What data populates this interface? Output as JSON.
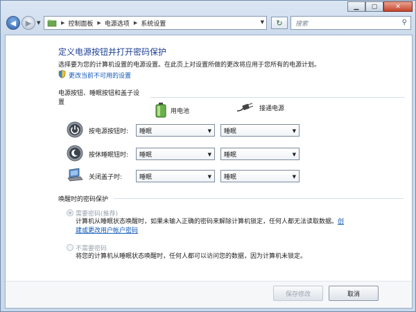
{
  "address": {
    "crumbs": [
      "控制面板",
      "电源选项",
      "系统设置"
    ]
  },
  "search": {
    "placeholder": "搜索"
  },
  "header": {
    "title": "定义电源按钮并打开密码保护",
    "description": "选择要为您的计算机设置的电源设置。在此页上对设置所做的更改将应用于您所有的电源计划。",
    "change_link": "更改当前不可用的设置"
  },
  "power_section": {
    "label": "电源按钮、睡眠按钮和盖子设置",
    "col_battery": "用电池",
    "col_plugged": "接通电源",
    "rows": [
      {
        "label": "按电源按钮时:",
        "battery": "睡眠",
        "plugged": "睡眠"
      },
      {
        "label": "按休睡眠钮时:",
        "battery": "睡眠",
        "plugged": "睡眠"
      },
      {
        "label": "关闭盖子时:",
        "battery": "睡眠",
        "plugged": "睡眠"
      }
    ]
  },
  "password_section": {
    "label": "唤醒时的密码保护",
    "option_require": {
      "label": "需要密码(推荐)",
      "desc_line1": "计算机从睡眠状态唤醒时，如果未输入正确的密码来解除计算机锁定，任何人都无法读取数据。",
      "link_part1": "创",
      "link_part2": "建或更改用户帐户密码"
    },
    "option_none": {
      "label": "不需要密码",
      "desc": "将您的计算机从睡眠状态唤醒时，任何人都可以访问您的数据，因为计算机未锁定。"
    }
  },
  "footer": {
    "save_label": "保存修改",
    "cancel_label": "取消"
  },
  "colors": {
    "title": "#1c3f94",
    "link": "#0e57b8"
  }
}
